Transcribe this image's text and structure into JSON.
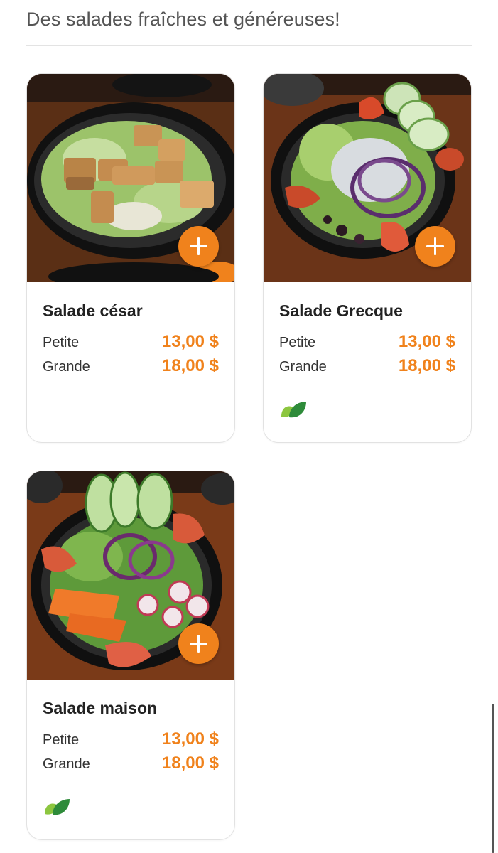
{
  "page": {
    "subtitle": "Des salades fraîches et généreuses!"
  },
  "colors": {
    "accent": "#f0821c",
    "leaf_green": "#3c9a2f"
  },
  "items": [
    {
      "name": "Salade césar",
      "sizes": [
        {
          "label": "Petite",
          "price": "13,00 $"
        },
        {
          "label": "Grande",
          "price": "18,00 $"
        }
      ],
      "vegetarian_icon": false,
      "add_icon": "plus-icon"
    },
    {
      "name": "Salade Grecque",
      "sizes": [
        {
          "label": "Petite",
          "price": "13,00 $"
        },
        {
          "label": "Grande",
          "price": "18,00 $"
        }
      ],
      "vegetarian_icon": "leaf-icon",
      "add_icon": "plus-icon"
    },
    {
      "name": "Salade maison",
      "sizes": [
        {
          "label": "Petite",
          "price": "13,00 $"
        },
        {
          "label": "Grande",
          "price": "18,00 $"
        }
      ],
      "vegetarian_icon": "leaf-icon",
      "add_icon": "plus-icon"
    }
  ]
}
